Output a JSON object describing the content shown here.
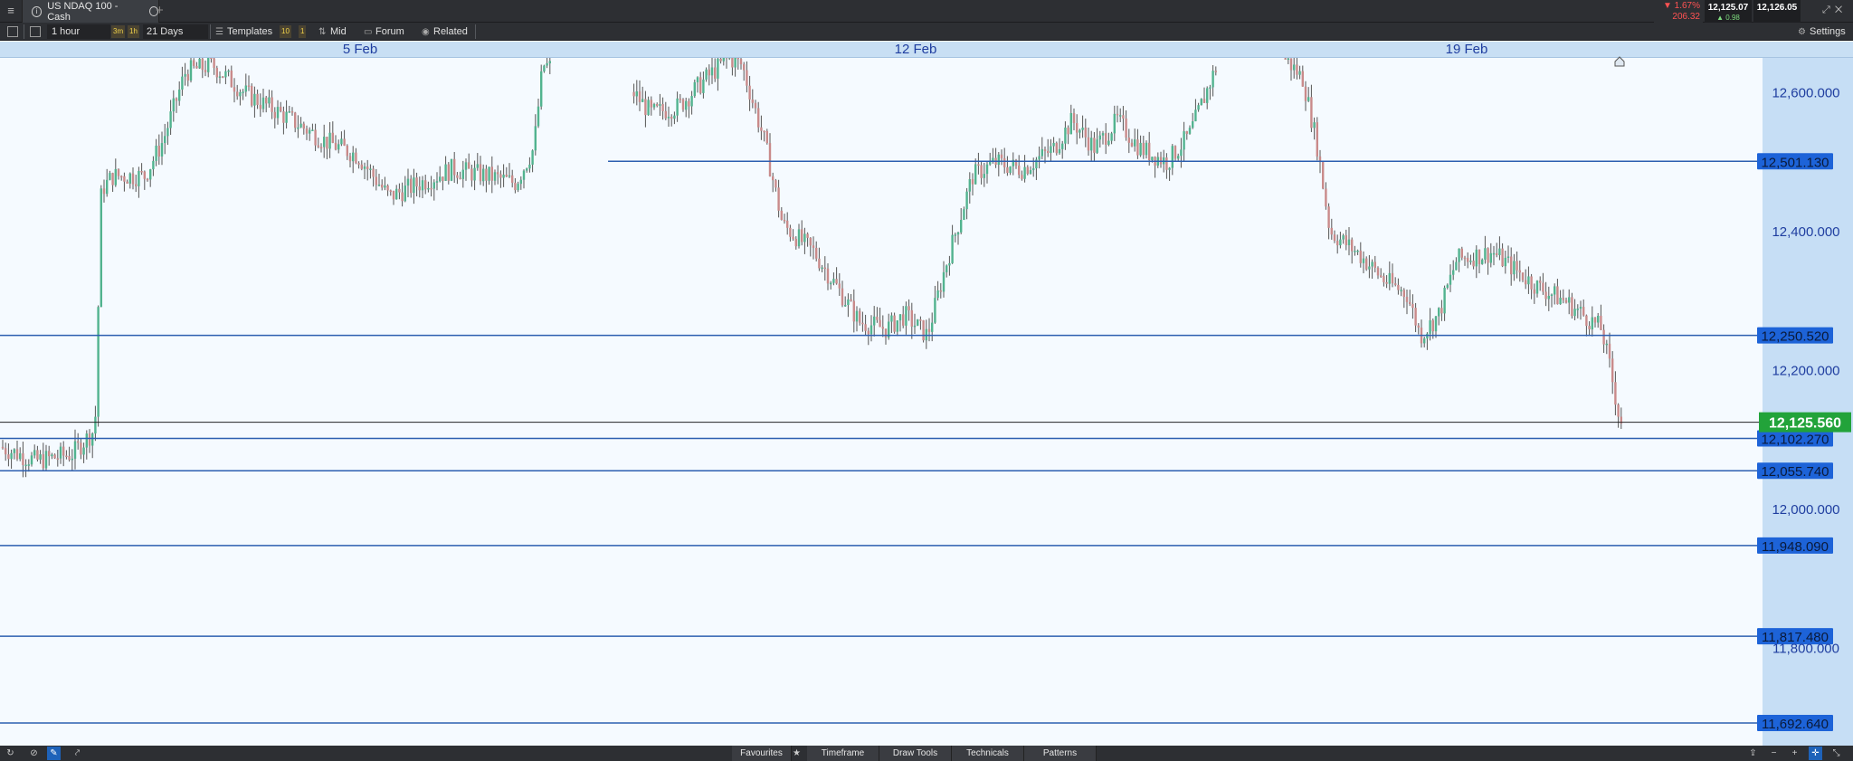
{
  "instrument_tab": {
    "title": "US NDAQ 100 - Cash",
    "info_icon": "info-icon",
    "search_icon": "search-icon"
  },
  "quotes": {
    "change_pct": "▼ 1.67%",
    "change_points": "206.32",
    "sell": "12,125.07",
    "spread": "▲ 0.98",
    "buy": "12,126.05"
  },
  "toolbar": {
    "timeframe": "1 hour",
    "quick_3m": "3m",
    "quick_1h": "1h",
    "range": "21 Days",
    "templates": "Templates",
    "badge_10": "10",
    "badge_1": "1",
    "price_type": "Mid",
    "forum": "Forum",
    "related": "Related",
    "settings": "Settings"
  },
  "dates": [
    {
      "label": "5 Feb",
      "x": 398
    },
    {
      "label": "12 Feb",
      "x": 1012
    },
    {
      "label": "19 Feb",
      "x": 1621
    }
  ],
  "bottom": {
    "favourites": "Favourites",
    "timeframe": "Timeframe",
    "draw_tools": "Draw Tools",
    "technicals": "Technicals",
    "patterns": "Patterns"
  },
  "chart_data": {
    "type": "candlestick",
    "ylim": [
      11660,
      12650
    ],
    "y_ticks": [
      {
        "label": "12,600.000",
        "value": 12600
      },
      {
        "label": "12,400.000",
        "value": 12400
      },
      {
        "label": "12,200.000",
        "value": 12200
      },
      {
        "label": "12,000.000",
        "value": 12000
      },
      {
        "label": "11,800.000",
        "value": 11800
      }
    ],
    "current_price": {
      "label": "12,125.560",
      "value": 12125.56,
      "color": "#22a33a"
    },
    "levels": [
      {
        "label": "12,501.130",
        "value": 12501.13,
        "x_start_frac": 0.345
      },
      {
        "label": "12,250.520",
        "value": 12250.52,
        "x_start_frac": 0
      },
      {
        "label": "12,102.270",
        "value": 12102.27,
        "x_start_frac": 0
      },
      {
        "label": "12,055.740",
        "value": 12055.74,
        "x_start_frac": 0
      },
      {
        "label": "11,948.090",
        "value": 11948.09,
        "x_start_frac": 0
      },
      {
        "label": "11,817.480",
        "value": 11817.48,
        "x_start_frac": 0
      },
      {
        "label": "11,692.640",
        "value": 11692.64,
        "x_start_frac": 0
      }
    ],
    "anchors": [
      [
        0,
        12090
      ],
      [
        40,
        12070
      ],
      [
        80,
        12080
      ],
      [
        105,
        12115
      ],
      [
        112,
        12460
      ],
      [
        125,
        12480
      ],
      [
        160,
        12480
      ],
      [
        180,
        12530
      ],
      [
        205,
        12630
      ],
      [
        235,
        12640
      ],
      [
        270,
        12600
      ],
      [
        310,
        12570
      ],
      [
        360,
        12530
      ],
      [
        395,
        12510
      ],
      [
        430,
        12450
      ],
      [
        465,
        12470
      ],
      [
        500,
        12490
      ],
      [
        540,
        12480
      ],
      [
        570,
        12470
      ],
      [
        590,
        12520
      ],
      [
        600,
        12640
      ],
      [
        700,
        12600
      ],
      [
        720,
        12570
      ],
      [
        750,
        12580
      ],
      [
        780,
        12620
      ],
      [
        805,
        12650
      ],
      [
        820,
        12640
      ],
      [
        845,
        12530
      ],
      [
        865,
        12410
      ],
      [
        900,
        12370
      ],
      [
        925,
        12320
      ],
      [
        950,
        12270
      ],
      [
        980,
        12260
      ],
      [
        1000,
        12280
      ],
      [
        1025,
        12250
      ],
      [
        1045,
        12350
      ],
      [
        1075,
        12480
      ],
      [
        1100,
        12500
      ],
      [
        1130,
        12490
      ],
      [
        1165,
        12520
      ],
      [
        1185,
        12560
      ],
      [
        1210,
        12520
      ],
      [
        1235,
        12560
      ],
      [
        1260,
        12520
      ],
      [
        1290,
        12500
      ],
      [
        1315,
        12540
      ],
      [
        1345,
        12640
      ],
      [
        1420,
        12650
      ],
      [
        1440,
        12620
      ],
      [
        1455,
        12530
      ],
      [
        1470,
        12400
      ],
      [
        1500,
        12370
      ],
      [
        1530,
        12330
      ],
      [
        1555,
        12310
      ],
      [
        1570,
        12250
      ],
      [
        1590,
        12280
      ],
      [
        1610,
        12360
      ],
      [
        1650,
        12370
      ],
      [
        1680,
        12340
      ],
      [
        1700,
        12320
      ],
      [
        1730,
        12300
      ],
      [
        1750,
        12280
      ],
      [
        1770,
        12260
      ],
      [
        1780,
        12200
      ],
      [
        1790,
        12130
      ],
      [
        1793,
        12126
      ]
    ],
    "gaps": [
      [
        610,
        700
      ],
      [
        1345,
        1420
      ]
    ]
  }
}
